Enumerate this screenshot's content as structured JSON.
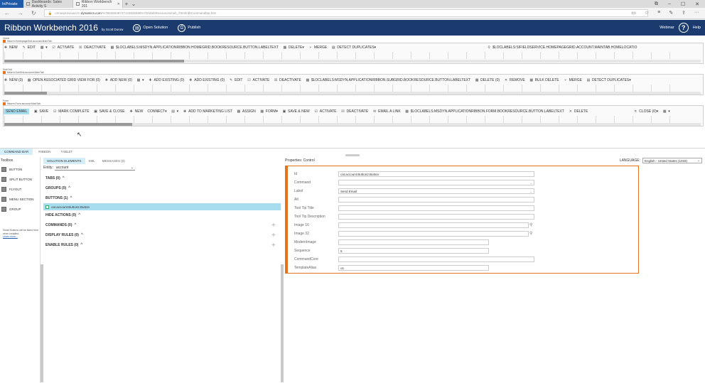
{
  "browser": {
    "inprivate": "InPrivate",
    "tabs": [
      {
        "label": "Dashboards: Sales Activity S"
      },
      {
        "label": "Ribbon Workbench 201"
      }
    ],
    "url_prefix": "crmuspreviewcrm.",
    "url_host": "dynamics.com",
    "url_suffix": "/%7B636549747123926585%7D/WebResources/rwb_/html/rdbCommandbar.htm"
  },
  "app": {
    "title": "Ribbon Workbench 2016",
    "byline": "by Scott Durow",
    "open_solution": "Open Solution",
    "publish": "Publish",
    "webinar": "Webinar",
    "help": "Help"
  },
  "ribbons": [
    {
      "label": "Home",
      "sub": "Mscrm.HomepageGrid.account.MainTab",
      "items": [
        "NEW",
        "EDIT",
        "",
        "ACTIVATE",
        "DEACTIVATE",
        "$LOCLABELS:MSDYN.APPLICATIONRIBBON.HOMEGRID.BOOKRESOURCE.BUTTON.LABELTEXT",
        "DELETE",
        "",
        "MERGE",
        "DETECT DUPLICATES",
        "",
        "",
        "",
        "",
        "",
        "",
        "",
        "$LOCLABELS:SIFIELDSERVICE.HOMEPAGEGRID.ACCOUNT.MAINTAB.HOMELOCATIO"
      ]
    },
    {
      "label": "SubGrid",
      "sub": "Mscrm.SubGrid.account.MainTab",
      "items": [
        "NEW (0)",
        "OPEN ASSOCIATED GRID VIEW FOR (0)",
        "ADD NEW (0)",
        "",
        "ADD EXISTING (0)",
        "ADD EXISTING (0)",
        "EDIT",
        "ACTIVATE",
        "DEACTIVATE",
        "$LOCLABELS:MSDYN.APPLICATIONRIBBON.SUBGRID.BOOKRESOURCE.BUTTON.LABELTEXT",
        "DELETE (0)",
        "REMOVE",
        "BULK DELETE",
        "MERGE",
        "DETECT DUPLICATES"
      ]
    },
    {
      "label": "Form",
      "sub": "Mscrm.Form.account.MainTab",
      "items": [
        "SEND EMAIL",
        "SAVE",
        "MARK COMPLETE",
        "SAVE & CLOSE",
        "NEW",
        "CONNECT",
        "",
        "ADD TO MARKETING LIST",
        "ASSIGN",
        "FORM",
        "SAVE & NEW",
        "ACTIVATE",
        "DEACTIVATE",
        "EMAIL A LINK",
        "$LOCLABELS:MSDYN.APPLICATIONRIBBON.FORM.BOOKRESOURCE.BUTTON.LABELTEXT",
        "DELETE",
        "",
        "",
        "",
        "CLOSE (0)",
        ""
      ]
    }
  ],
  "view_tabs": [
    "COMMAND BAR",
    "RIBBON",
    "TABLET"
  ],
  "toolbox": {
    "title": "Toolbox",
    "items": [
      "BUTTON",
      "SPLIT BUTTON",
      "FLYOUT",
      "MENU SECTION",
      "GROUP"
    ],
    "hint": "Smart Buttons will be listed here when installed.",
    "learn": "Learn more..."
  },
  "solution": {
    "tabs": [
      "SOLUTION ELEMENTS",
      "XML",
      "MESSAGES (0)"
    ],
    "entity_label": "Entity:",
    "entity_value": "account",
    "groups": [
      "TABS (0)",
      "GROUPS (0)",
      "BUTTONS (1)",
      "HIDE ACTIONS (0)",
      "COMMANDS (0)",
      "DISPLAY RULES (0)",
      "ENABLE RULES (0)"
    ],
    "selected": "cat.account.Button2.Button"
  },
  "properties": {
    "title": "Properties: Control",
    "language_label": "LANGUAGE:",
    "language_value": "English - United States (1033)",
    "fields": [
      {
        "label": "Id",
        "value": ""
      },
      {
        "label": "Command",
        "value": ""
      },
      {
        "label": "Label",
        "value": "Send Email"
      },
      {
        "label": "Alt",
        "value": ""
      },
      {
        "label": "Tool Tip Title",
        "value": ""
      },
      {
        "label": "Tool Tip Description",
        "value": ""
      },
      {
        "label": "Image 16",
        "value": ""
      },
      {
        "label": "Image 32",
        "value": ""
      },
      {
        "label": "ModernImage",
        "value": ""
      },
      {
        "label": "Sequence",
        "value": "5"
      },
      {
        "label": "CommandCore",
        "value": ""
      },
      {
        "label": "TemplateAlias",
        "value": "o1"
      }
    ],
    "id_value": "cat.account.Button2.Button"
  }
}
